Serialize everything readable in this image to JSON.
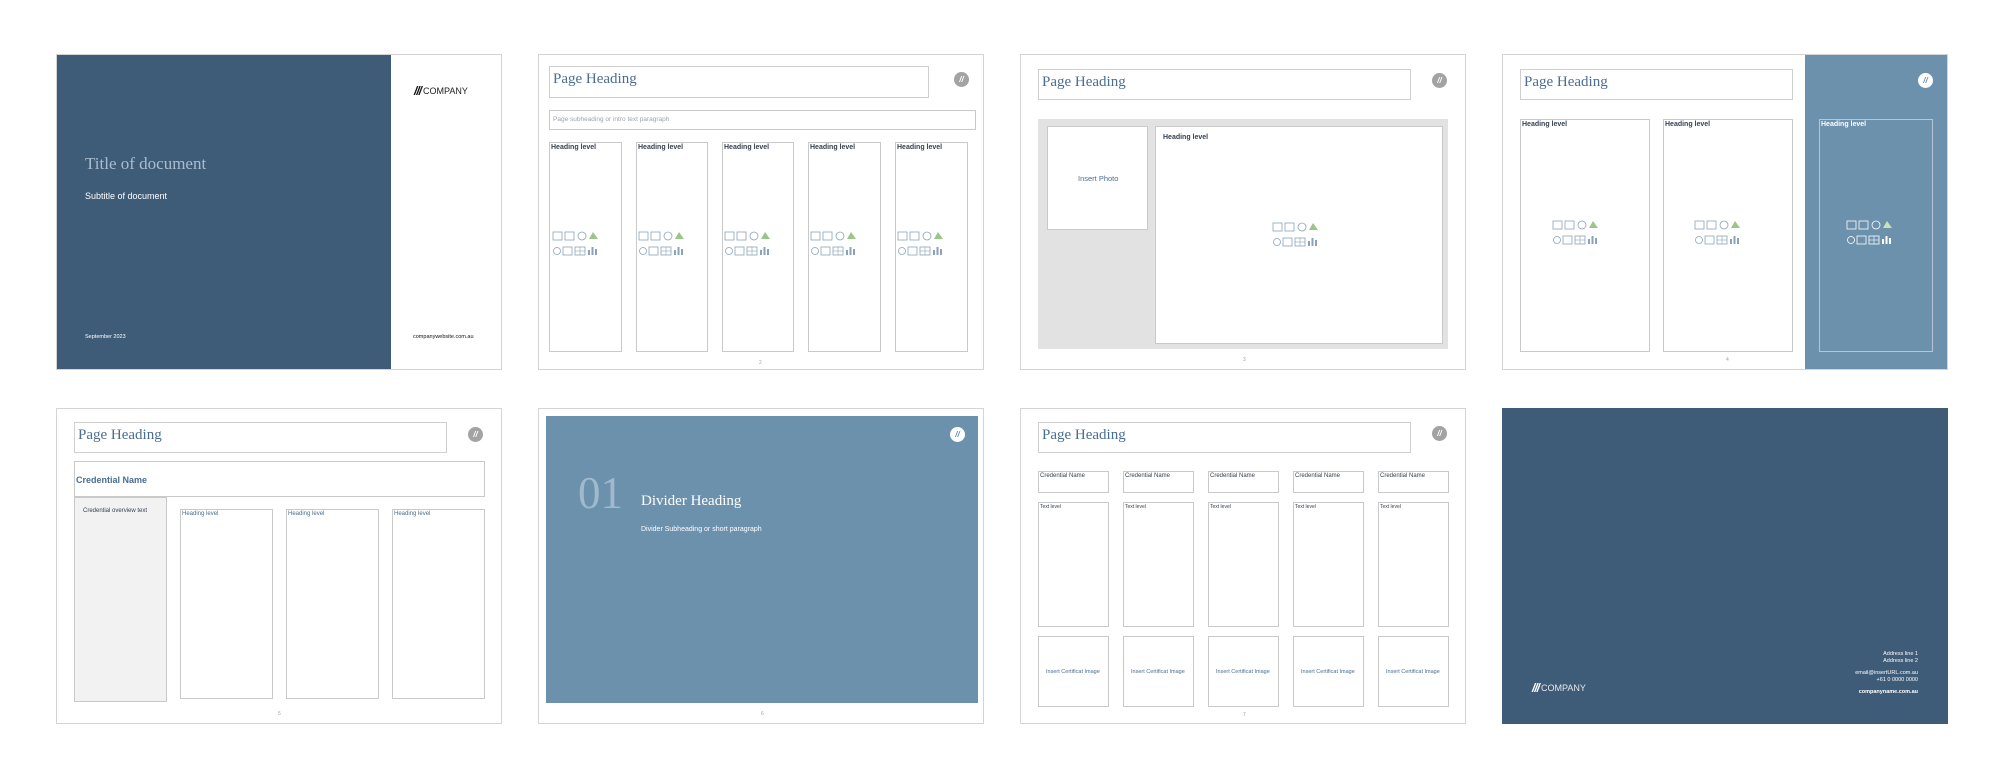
{
  "colors": {
    "navy": "#3e5b78",
    "steel": "#6c91ad",
    "heading_blue": "#4a6d92",
    "gray_panel": "#e2e2e2"
  },
  "slide1": {
    "logo_text": "COMPANY",
    "title": "Title of document",
    "subtitle": "Subtitle of document",
    "date": "September 2023",
    "website": "companywebsite.com.au"
  },
  "slide2": {
    "heading": "Page Heading",
    "subheading": "Page subheading or intro text paragraph",
    "columns": [
      "Heading level",
      "Heading level",
      "Heading level",
      "Heading level",
      "Heading level"
    ],
    "page": "2"
  },
  "slide3": {
    "heading": "Page Heading",
    "photo": "Insert Photo",
    "panel_heading": "Heading level",
    "page": "3"
  },
  "slide4": {
    "heading": "Page Heading",
    "columns": [
      "Heading level",
      "Heading level"
    ],
    "side_heading": "Heading level",
    "page": "4"
  },
  "slide5": {
    "heading": "Page Heading",
    "credential": "Credential Name",
    "overview": "Credential overview text",
    "columns": [
      "Heading level",
      "Heading level",
      "Heading level"
    ],
    "page": "5"
  },
  "slide6": {
    "number": "01",
    "heading": "Divider Heading",
    "subheading": "Divider Subheading or short paragraph",
    "page": "6"
  },
  "slide7": {
    "heading": "Page Heading",
    "credentials": [
      "Credential Name",
      "Credential Name",
      "Credential Name",
      "Credential Name",
      "Credential Name"
    ],
    "text_level": "Text level",
    "insert": "Insert Certificat Image",
    "page": "7"
  },
  "slide8": {
    "address1": "Address line 1",
    "address2": "Address line 2",
    "email": "email@insertURL.com.au",
    "phone": "+61 0 0000 0000",
    "website": "companyname.com.au",
    "logo_text": "COMPANY"
  }
}
